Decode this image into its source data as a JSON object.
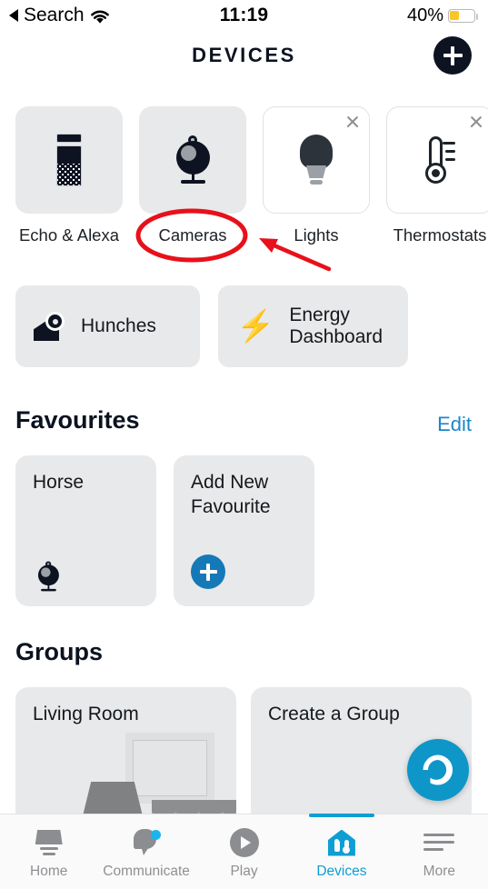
{
  "status_bar": {
    "back_label": "Search",
    "wifi_icon": "wifi-icon",
    "time": "11:19",
    "battery_percent": "40%",
    "battery_level": 40,
    "battery_color": "#fcc425"
  },
  "header": {
    "title": "DEVICES",
    "add_button_icon": "plus-icon"
  },
  "categories": [
    {
      "label": "Echo & Alexa",
      "icon": "echo-speaker-icon",
      "style": "filled",
      "closable": false
    },
    {
      "label": "Cameras",
      "icon": "camera-icon",
      "style": "filled",
      "closable": false
    },
    {
      "label": "Lights",
      "icon": "lightbulb-icon",
      "style": "outline",
      "closable": true
    },
    {
      "label": "Thermostats",
      "icon": "thermometer-icon",
      "style": "outline",
      "closable": true
    }
  ],
  "shortcuts": [
    {
      "label": "Hunches",
      "icon": "home-gear-icon"
    },
    {
      "label": "Energy\nDashboard",
      "label_line1": "Energy",
      "label_line2": "Dashboard",
      "icon": "lightning-bolt-icon"
    }
  ],
  "favourites": {
    "title": "Favourites",
    "edit_label": "Edit",
    "cards": [
      {
        "title": "Horse",
        "icon": "camera-icon"
      },
      {
        "title_line1": "Add New",
        "title_line2": "Favourite",
        "icon": "plus-circle-icon"
      }
    ]
  },
  "groups": {
    "title": "Groups",
    "cards": [
      {
        "title": "Living Room",
        "art": "living-room-illustration"
      },
      {
        "title": "Create a Group",
        "art": "none"
      }
    ]
  },
  "fab": {
    "icon": "alexa-logo-icon",
    "color": "#0e96c9"
  },
  "tabs": [
    {
      "label": "Home",
      "icon": "home-icon",
      "active": false,
      "badge": false
    },
    {
      "label": "Communicate",
      "icon": "chat-bubble-icon",
      "active": false,
      "badge": true
    },
    {
      "label": "Play",
      "icon": "play-icon",
      "active": false,
      "badge": false
    },
    {
      "label": "Devices",
      "icon": "devices-house-icon",
      "active": true,
      "badge": false
    },
    {
      "label": "More",
      "icon": "hamburger-icon",
      "active": false,
      "badge": false
    }
  ],
  "annotations": {
    "color": "#e8101a",
    "ellipse_target": "Cameras",
    "arrow_points_to": "Cameras"
  },
  "accent_colors": {
    "link_blue": "#1c87c9",
    "tab_active": "#0e9ed4",
    "tile_gray": "#e8e9ea",
    "dark": "#0d1321"
  }
}
